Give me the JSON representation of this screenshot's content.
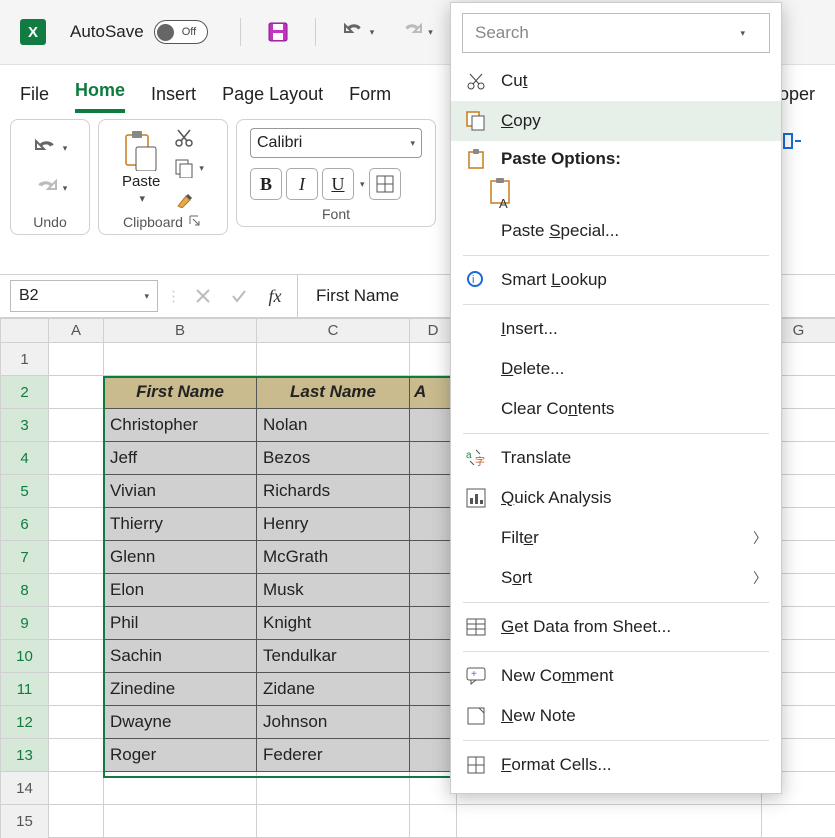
{
  "titlebar": {
    "autosave_label": "AutoSave",
    "autosave_state": "Off"
  },
  "tabs": {
    "file": "File",
    "home": "Home",
    "insert": "Insert",
    "page_layout": "Page Layout",
    "form_partial": "Form",
    "developer_partial": "loper",
    "active": "home"
  },
  "ribbon": {
    "undo_group": "Undo",
    "clipboard_group": "Clipboard",
    "paste_label": "Paste",
    "font_group": "Font",
    "font_name": "Calibri"
  },
  "formula_bar": {
    "cell_ref": "B2",
    "value": "First Name"
  },
  "grid": {
    "columns": [
      "A",
      "B",
      "C",
      "D",
      "G"
    ],
    "row_count": 15,
    "headers": [
      "First Name",
      "Last Name",
      "A"
    ],
    "data": [
      {
        "first": "Christopher",
        "last": "Nolan"
      },
      {
        "first": "Jeff",
        "last": "Bezos"
      },
      {
        "first": "Vivian",
        "last": "Richards"
      },
      {
        "first": "Thierry",
        "last": "Henry"
      },
      {
        "first": "Glenn",
        "last": "McGrath"
      },
      {
        "first": "Elon",
        "last": "Musk"
      },
      {
        "first": "Phil",
        "last": "Knight"
      },
      {
        "first": "Sachin",
        "last": "Tendulkar"
      },
      {
        "first": "Zinedine",
        "last": "Zidane"
      },
      {
        "first": "Dwayne",
        "last": "Johnson"
      },
      {
        "first": "Roger",
        "last": "Federer"
      }
    ],
    "selection": "B2:D13"
  },
  "context_menu": {
    "search_placeholder": "Search",
    "items": {
      "cut": "Cut",
      "copy": "Copy",
      "paste_options": "Paste Options:",
      "paste_special": "Paste Special...",
      "smart_lookup": "Smart Lookup",
      "insert": "Insert...",
      "delete": "Delete...",
      "clear_contents": "Clear Contents",
      "translate": "Translate",
      "quick_analysis": "Quick Analysis",
      "filter": "Filter",
      "sort": "Sort",
      "get_data": "Get Data from Sheet...",
      "new_comment": "New Comment",
      "new_note": "New Note",
      "format_cells": "Format Cells..."
    }
  }
}
